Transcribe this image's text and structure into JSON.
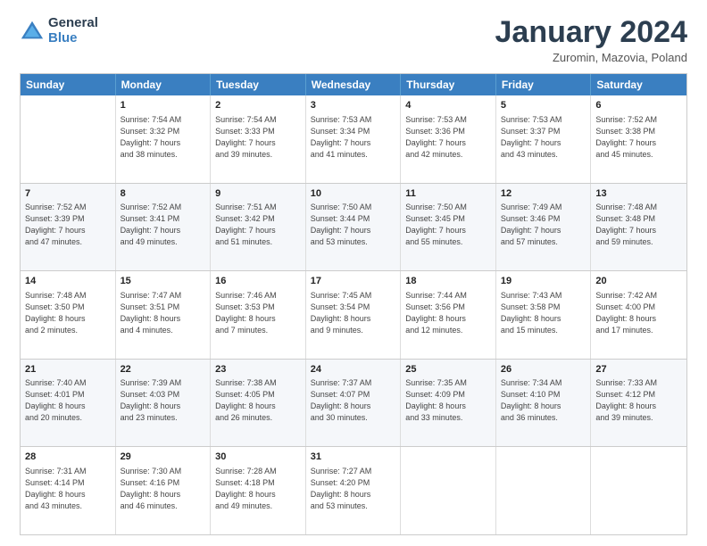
{
  "logo": {
    "line1": "General",
    "line2": "Blue"
  },
  "title": "January 2024",
  "subtitle": "Zuromin, Mazovia, Poland",
  "header_days": [
    "Sunday",
    "Monday",
    "Tuesday",
    "Wednesday",
    "Thursday",
    "Friday",
    "Saturday"
  ],
  "rows": [
    [
      {
        "day": "",
        "info": ""
      },
      {
        "day": "1",
        "info": "Sunrise: 7:54 AM\nSunset: 3:32 PM\nDaylight: 7 hours\nand 38 minutes."
      },
      {
        "day": "2",
        "info": "Sunrise: 7:54 AM\nSunset: 3:33 PM\nDaylight: 7 hours\nand 39 minutes."
      },
      {
        "day": "3",
        "info": "Sunrise: 7:53 AM\nSunset: 3:34 PM\nDaylight: 7 hours\nand 41 minutes."
      },
      {
        "day": "4",
        "info": "Sunrise: 7:53 AM\nSunset: 3:36 PM\nDaylight: 7 hours\nand 42 minutes."
      },
      {
        "day": "5",
        "info": "Sunrise: 7:53 AM\nSunset: 3:37 PM\nDaylight: 7 hours\nand 43 minutes."
      },
      {
        "day": "6",
        "info": "Sunrise: 7:52 AM\nSunset: 3:38 PM\nDaylight: 7 hours\nand 45 minutes."
      }
    ],
    [
      {
        "day": "7",
        "info": "Sunrise: 7:52 AM\nSunset: 3:39 PM\nDaylight: 7 hours\nand 47 minutes."
      },
      {
        "day": "8",
        "info": "Sunrise: 7:52 AM\nSunset: 3:41 PM\nDaylight: 7 hours\nand 49 minutes."
      },
      {
        "day": "9",
        "info": "Sunrise: 7:51 AM\nSunset: 3:42 PM\nDaylight: 7 hours\nand 51 minutes."
      },
      {
        "day": "10",
        "info": "Sunrise: 7:50 AM\nSunset: 3:44 PM\nDaylight: 7 hours\nand 53 minutes."
      },
      {
        "day": "11",
        "info": "Sunrise: 7:50 AM\nSunset: 3:45 PM\nDaylight: 7 hours\nand 55 minutes."
      },
      {
        "day": "12",
        "info": "Sunrise: 7:49 AM\nSunset: 3:46 PM\nDaylight: 7 hours\nand 57 minutes."
      },
      {
        "day": "13",
        "info": "Sunrise: 7:48 AM\nSunset: 3:48 PM\nDaylight: 7 hours\nand 59 minutes."
      }
    ],
    [
      {
        "day": "14",
        "info": "Sunrise: 7:48 AM\nSunset: 3:50 PM\nDaylight: 8 hours\nand 2 minutes."
      },
      {
        "day": "15",
        "info": "Sunrise: 7:47 AM\nSunset: 3:51 PM\nDaylight: 8 hours\nand 4 minutes."
      },
      {
        "day": "16",
        "info": "Sunrise: 7:46 AM\nSunset: 3:53 PM\nDaylight: 8 hours\nand 7 minutes."
      },
      {
        "day": "17",
        "info": "Sunrise: 7:45 AM\nSunset: 3:54 PM\nDaylight: 8 hours\nand 9 minutes."
      },
      {
        "day": "18",
        "info": "Sunrise: 7:44 AM\nSunset: 3:56 PM\nDaylight: 8 hours\nand 12 minutes."
      },
      {
        "day": "19",
        "info": "Sunrise: 7:43 AM\nSunset: 3:58 PM\nDaylight: 8 hours\nand 15 minutes."
      },
      {
        "day": "20",
        "info": "Sunrise: 7:42 AM\nSunset: 4:00 PM\nDaylight: 8 hours\nand 17 minutes."
      }
    ],
    [
      {
        "day": "21",
        "info": "Sunrise: 7:40 AM\nSunset: 4:01 PM\nDaylight: 8 hours\nand 20 minutes."
      },
      {
        "day": "22",
        "info": "Sunrise: 7:39 AM\nSunset: 4:03 PM\nDaylight: 8 hours\nand 23 minutes."
      },
      {
        "day": "23",
        "info": "Sunrise: 7:38 AM\nSunset: 4:05 PM\nDaylight: 8 hours\nand 26 minutes."
      },
      {
        "day": "24",
        "info": "Sunrise: 7:37 AM\nSunset: 4:07 PM\nDaylight: 8 hours\nand 30 minutes."
      },
      {
        "day": "25",
        "info": "Sunrise: 7:35 AM\nSunset: 4:09 PM\nDaylight: 8 hours\nand 33 minutes."
      },
      {
        "day": "26",
        "info": "Sunrise: 7:34 AM\nSunset: 4:10 PM\nDaylight: 8 hours\nand 36 minutes."
      },
      {
        "day": "27",
        "info": "Sunrise: 7:33 AM\nSunset: 4:12 PM\nDaylight: 8 hours\nand 39 minutes."
      }
    ],
    [
      {
        "day": "28",
        "info": "Sunrise: 7:31 AM\nSunset: 4:14 PM\nDaylight: 8 hours\nand 43 minutes."
      },
      {
        "day": "29",
        "info": "Sunrise: 7:30 AM\nSunset: 4:16 PM\nDaylight: 8 hours\nand 46 minutes."
      },
      {
        "day": "30",
        "info": "Sunrise: 7:28 AM\nSunset: 4:18 PM\nDaylight: 8 hours\nand 49 minutes."
      },
      {
        "day": "31",
        "info": "Sunrise: 7:27 AM\nSunset: 4:20 PM\nDaylight: 8 hours\nand 53 minutes."
      },
      {
        "day": "",
        "info": ""
      },
      {
        "day": "",
        "info": ""
      },
      {
        "day": "",
        "info": ""
      }
    ]
  ]
}
